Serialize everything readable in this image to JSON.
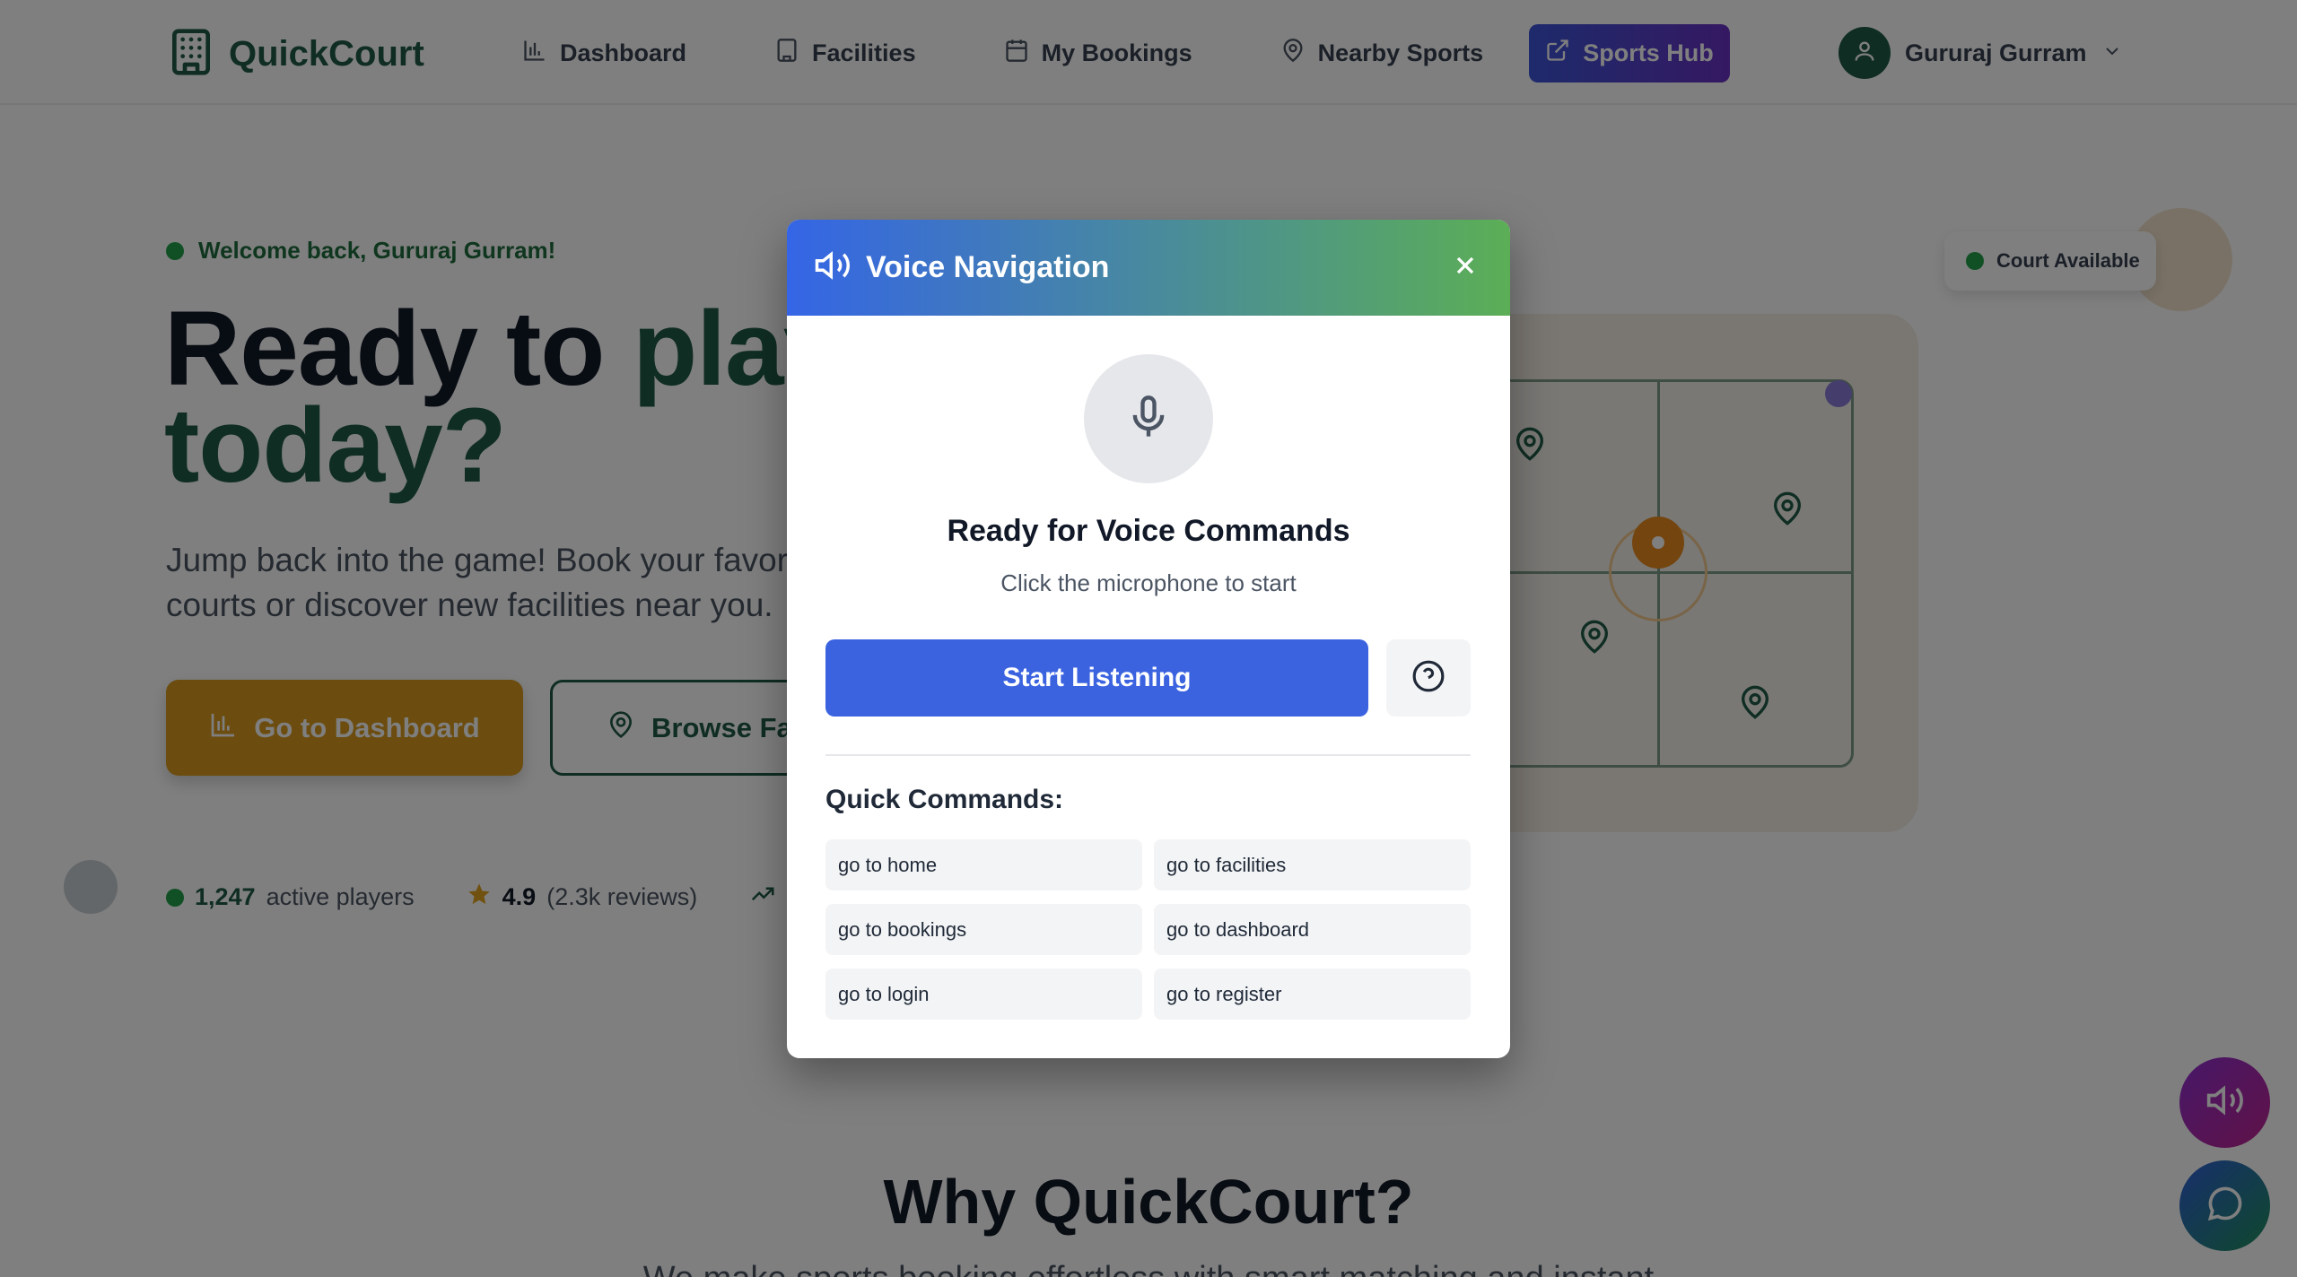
{
  "header": {
    "brand": "QuickCourt",
    "nav": [
      {
        "label": "Dashboard",
        "icon": "bar-chart-icon"
      },
      {
        "label": "Facilities",
        "icon": "building-icon"
      },
      {
        "label": "My Bookings",
        "icon": "calendar-icon"
      },
      {
        "label": "Nearby Sports",
        "icon": "map-pin-icon"
      }
    ],
    "sports_hub": "Sports Hub",
    "user_name": "Gururaj Gurram"
  },
  "hero": {
    "welcome": "Welcome back, Gururaj Gurram!",
    "title_part1": "Ready to ",
    "title_accent": "play",
    "title_part2": "today?",
    "subtitle": "Jump back into the game! Book your favorite courts or discover new facilities near you.",
    "btn_dashboard": "Go to Dashboard",
    "btn_browse": "Browse Facilities",
    "stats": {
      "players_count": "1,247",
      "players_label": "active players",
      "rating": "4.9",
      "reviews": "(2.3k reviews)"
    }
  },
  "map": {
    "court_badge": "Court Available"
  },
  "section": {
    "why_title": "Why QuickCourt?",
    "why_sub": "We make sports booking effortless with smart matching and instant"
  },
  "modal": {
    "title": "Voice Navigation",
    "ready_title": "Ready for Voice Commands",
    "ready_sub": "Click the microphone to start",
    "start_button": "Start Listening",
    "quick_title": "Quick Commands:",
    "commands": [
      "go to home",
      "go to facilities",
      "go to bookings",
      "go to dashboard",
      "go to login",
      "go to register"
    ]
  },
  "colors": {
    "brand_green": "#1e5a46",
    "accent_gold": "#d99a1e",
    "primary_blue": "#3b63e0"
  }
}
